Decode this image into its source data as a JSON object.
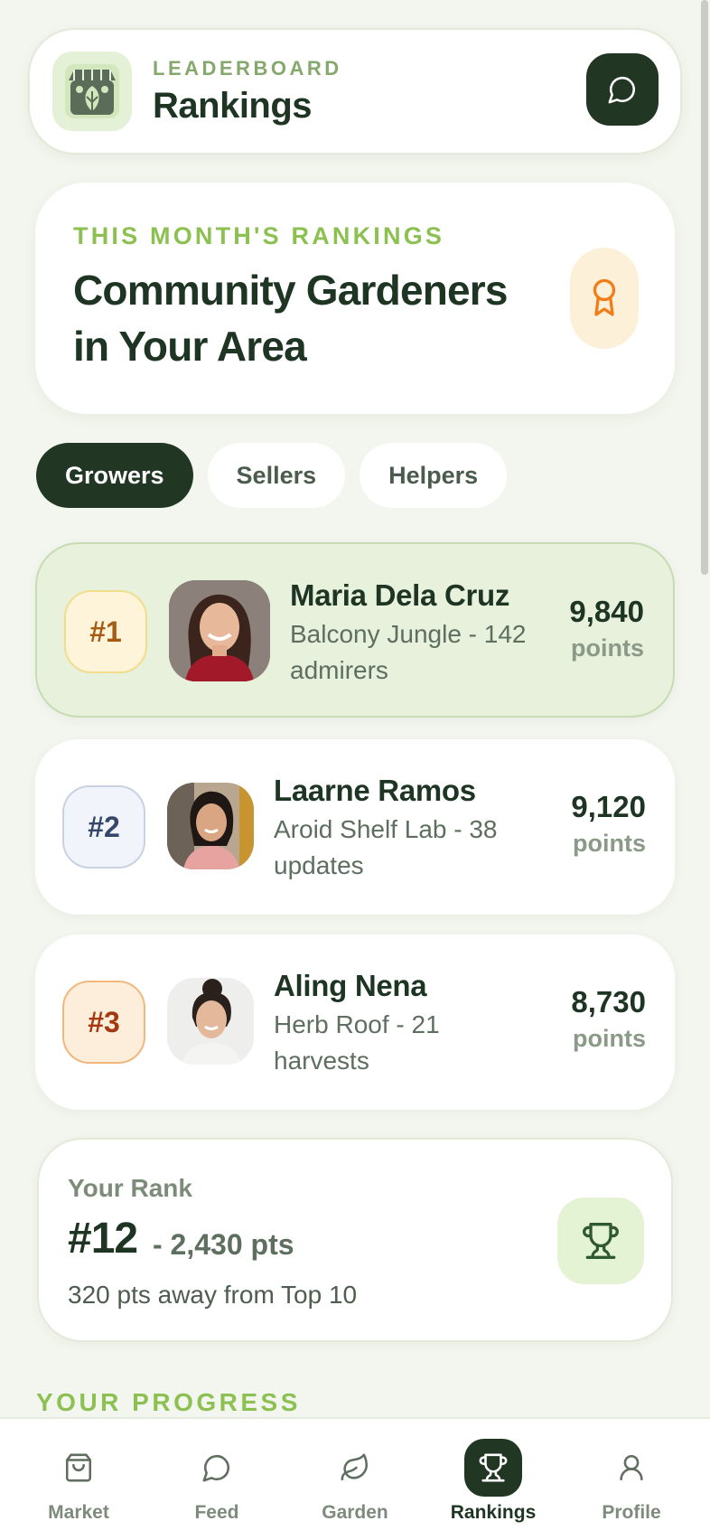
{
  "header": {
    "eyebrow": "LEADERBOARD",
    "title": "Rankings",
    "logo_icon": "plant-shop-icon",
    "chat_icon": "chat-bubble-icon"
  },
  "hero": {
    "eyebrow": "THIS MONTH'S RANKINGS",
    "title": "Community Gardeners in Your Area",
    "badge_icon": "award-ribbon-icon"
  },
  "tabs": [
    {
      "label": "Growers",
      "active": true
    },
    {
      "label": "Sellers",
      "active": false
    },
    {
      "label": "Helpers",
      "active": false
    }
  ],
  "leaders": [
    {
      "rank": "#1",
      "name": "Maria Dela Cruz",
      "desc": "Balcony Jungle - 142 admirers",
      "points": "9,840",
      "unit": "points"
    },
    {
      "rank": "#2",
      "name": "Laarne Ramos",
      "desc": "Aroid Shelf Lab - 38 updates",
      "points": "9,120",
      "unit": "points"
    },
    {
      "rank": "#3",
      "name": "Aling Nena",
      "desc": "Herb Roof - 21 harvests",
      "points": "8,730",
      "unit": "points"
    }
  ],
  "your_rank": {
    "label": "Your Rank",
    "rank": "#12",
    "points": "- 2,430 pts",
    "away": "320 pts away from Top 10",
    "icon": "trophy-icon"
  },
  "progress_heading": "YOUR PROGRESS",
  "nav": [
    {
      "label": "Market",
      "icon": "shopping-bag-icon",
      "active": false
    },
    {
      "label": "Feed",
      "icon": "chat-bubble-icon",
      "active": false
    },
    {
      "label": "Garden",
      "icon": "leaf-icon",
      "active": false
    },
    {
      "label": "Rankings",
      "icon": "trophy-icon",
      "active": true
    },
    {
      "label": "Profile",
      "icon": "user-icon",
      "active": false
    }
  ],
  "colors": {
    "background": "#f3f6ee",
    "dark_green": "#223624",
    "accent_green": "#8cc152",
    "first_place_bg": "#e7f1dc"
  }
}
